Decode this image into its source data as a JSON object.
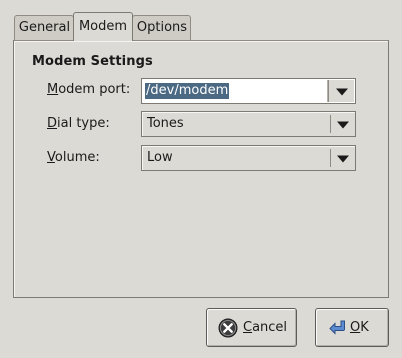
{
  "tabs": [
    {
      "label": "General"
    },
    {
      "label": "Modem"
    },
    {
      "label": "Options"
    }
  ],
  "section": {
    "title": "Modem Settings"
  },
  "fields": {
    "modem_port": {
      "label_mnemonic": "M",
      "label_rest": "odem port:",
      "value": "/dev/modem"
    },
    "dial_type": {
      "label_mnemonic": "D",
      "label_rest": "ial type:",
      "value": "Tones"
    },
    "volume": {
      "label_mnemonic": "V",
      "label_rest": "olume:",
      "value": "Low"
    }
  },
  "buttons": {
    "cancel": {
      "mnemonic": "C",
      "rest": "ancel",
      "icon": "cancel-icon"
    },
    "ok": {
      "mnemonic": "O",
      "rest": "K",
      "icon": "ok-enter-arrow-icon"
    }
  },
  "colors": {
    "background": "#dcdad5",
    "selection": "#4b6983",
    "cancel_icon": "#3c3c3c",
    "ok_icon": "#3f6fb5"
  }
}
